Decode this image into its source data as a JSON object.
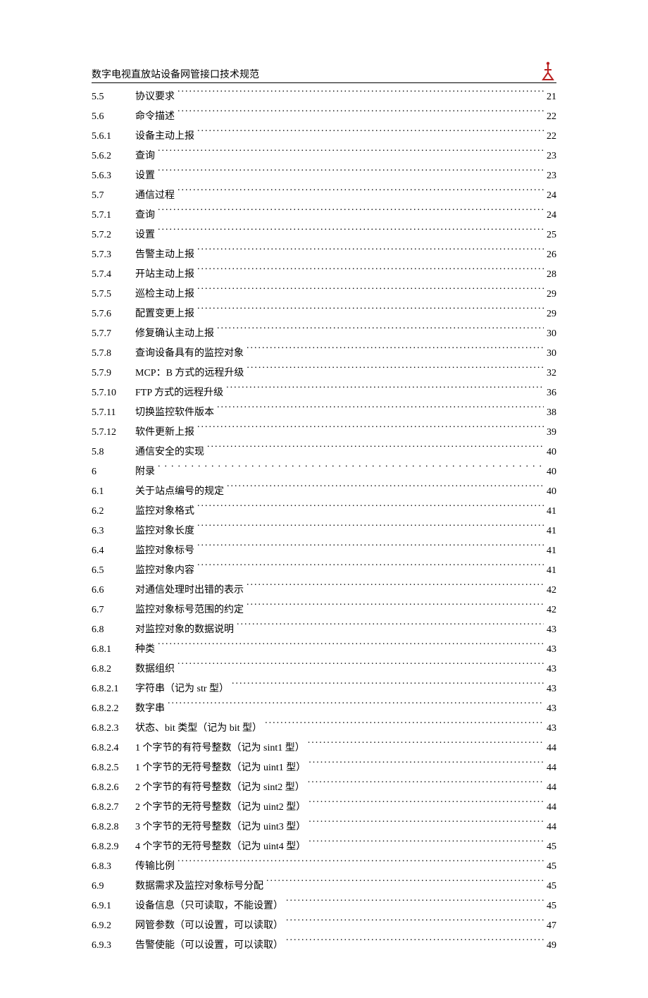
{
  "header": {
    "title": "数字电视直放站设备网管接口技术规范"
  },
  "toc": [
    {
      "num": "5.5",
      "title": "协议要求",
      "page": "21",
      "spaced": false
    },
    {
      "num": "5.6",
      "title": "命令描述",
      "page": "22",
      "spaced": false
    },
    {
      "num": "5.6.1",
      "title": "设备主动上报",
      "page": "22",
      "spaced": false
    },
    {
      "num": "5.6.2",
      "title": "查询",
      "page": "23",
      "spaced": false
    },
    {
      "num": "5.6.3",
      "title": "设置",
      "page": "23",
      "spaced": false
    },
    {
      "num": "5.7",
      "title": "通信过程",
      "page": "24",
      "spaced": false
    },
    {
      "num": "5.7.1",
      "title": "查询",
      "page": "24",
      "spaced": false
    },
    {
      "num": "5.7.2",
      "title": "设置",
      "page": "25",
      "spaced": false
    },
    {
      "num": "5.7.3",
      "title": "告警主动上报",
      "page": "26",
      "spaced": false
    },
    {
      "num": "5.7.4",
      "title": "开站主动上报",
      "page": "28",
      "spaced": false
    },
    {
      "num": "5.7.5",
      "title": "巡检主动上报",
      "page": "29",
      "spaced": false
    },
    {
      "num": "5.7.6",
      "title": "配置变更上报",
      "page": "29",
      "spaced": false
    },
    {
      "num": "5.7.7",
      "title": "修复确认主动上报",
      "page": "30",
      "spaced": false
    },
    {
      "num": "5.7.8",
      "title": "查询设备具有的监控对象",
      "page": "30",
      "spaced": false
    },
    {
      "num": "5.7.9",
      "title": "MCP：B 方式的远程升级",
      "page": "32",
      "spaced": false
    },
    {
      "num": "5.7.10",
      "title": "FTP 方式的远程升级",
      "page": "36",
      "spaced": false
    },
    {
      "num": "5.7.11",
      "title": "切换监控软件版本",
      "page": "38",
      "spaced": false
    },
    {
      "num": "5.7.12",
      "title": "软件更新上报",
      "page": "39",
      "spaced": false
    },
    {
      "num": "5.8",
      "title": "通信安全的实现",
      "page": "40",
      "spaced": false
    },
    {
      "num": "6",
      "title": "附录",
      "page": "40",
      "spaced": true
    },
    {
      "num": "6.1",
      "title": "关于站点编号的规定",
      "page": "40",
      "spaced": false
    },
    {
      "num": "6.2",
      "title": "监控对象格式",
      "page": "41",
      "spaced": false
    },
    {
      "num": "6.3",
      "title": "监控对象长度",
      "page": "41",
      "spaced": false
    },
    {
      "num": "6.4",
      "title": "监控对象标号",
      "page": "41",
      "spaced": false
    },
    {
      "num": "6.5",
      "title": "监控对象内容",
      "page": "41",
      "spaced": false
    },
    {
      "num": "6.6",
      "title": "对通信处理时出错的表示",
      "page": "42",
      "spaced": false
    },
    {
      "num": "6.7",
      "title": "监控对象标号范围的约定",
      "page": "42",
      "spaced": false
    },
    {
      "num": "6.8",
      "title": "对监控对象的数据说明",
      "page": "43",
      "spaced": false
    },
    {
      "num": "6.8.1",
      "title": "种类",
      "page": "43",
      "spaced": false
    },
    {
      "num": "6.8.2",
      "title": "数据组织",
      "page": "43",
      "spaced": false
    },
    {
      "num": "6.8.2.1",
      "title": "字符串（记为 str 型）",
      "page": "43",
      "spaced": false
    },
    {
      "num": "6.8.2.2",
      "title": "数字串",
      "page": "43",
      "spaced": false
    },
    {
      "num": "6.8.2.3",
      "title": "状态、bit 类型（记为 bit 型）",
      "page": "43",
      "spaced": false
    },
    {
      "num": "6.8.2.4",
      "title": "1 个字节的有符号整数（记为 sint1 型）",
      "page": "44",
      "spaced": false
    },
    {
      "num": "6.8.2.5",
      "title": "1 个字节的无符号整数（记为 uint1 型）",
      "page": "44",
      "spaced": false
    },
    {
      "num": "6.8.2.6",
      "title": "2 个字节的有符号整数（记为 sint2 型）",
      "page": "44",
      "spaced": false
    },
    {
      "num": "6.8.2.7",
      "title": "2 个字节的无符号整数（记为 uint2 型）",
      "page": "44",
      "spaced": false
    },
    {
      "num": "6.8.2.8",
      "title": "3 个字节的无符号整数（记为 uint3 型）",
      "page": "44",
      "spaced": false
    },
    {
      "num": "6.8.2.9",
      "title": "4 个字节的无符号整数（记为 uint4 型）",
      "page": "45",
      "spaced": false
    },
    {
      "num": "6.8.3",
      "title": "传输比例",
      "page": "45",
      "spaced": false
    },
    {
      "num": "6.9",
      "title": "数据需求及监控对象标号分配",
      "page": "45",
      "spaced": false
    },
    {
      "num": "6.9.1",
      "title": "设备信息（只可读取，不能设置）",
      "page": "45",
      "spaced": false
    },
    {
      "num": "6.9.2",
      "title": "网管参数（可以设置，可以读取）",
      "page": "47",
      "spaced": false
    },
    {
      "num": "6.9.3",
      "title": "告警使能（可以设置，可以读取）",
      "page": "49",
      "spaced": false
    }
  ]
}
